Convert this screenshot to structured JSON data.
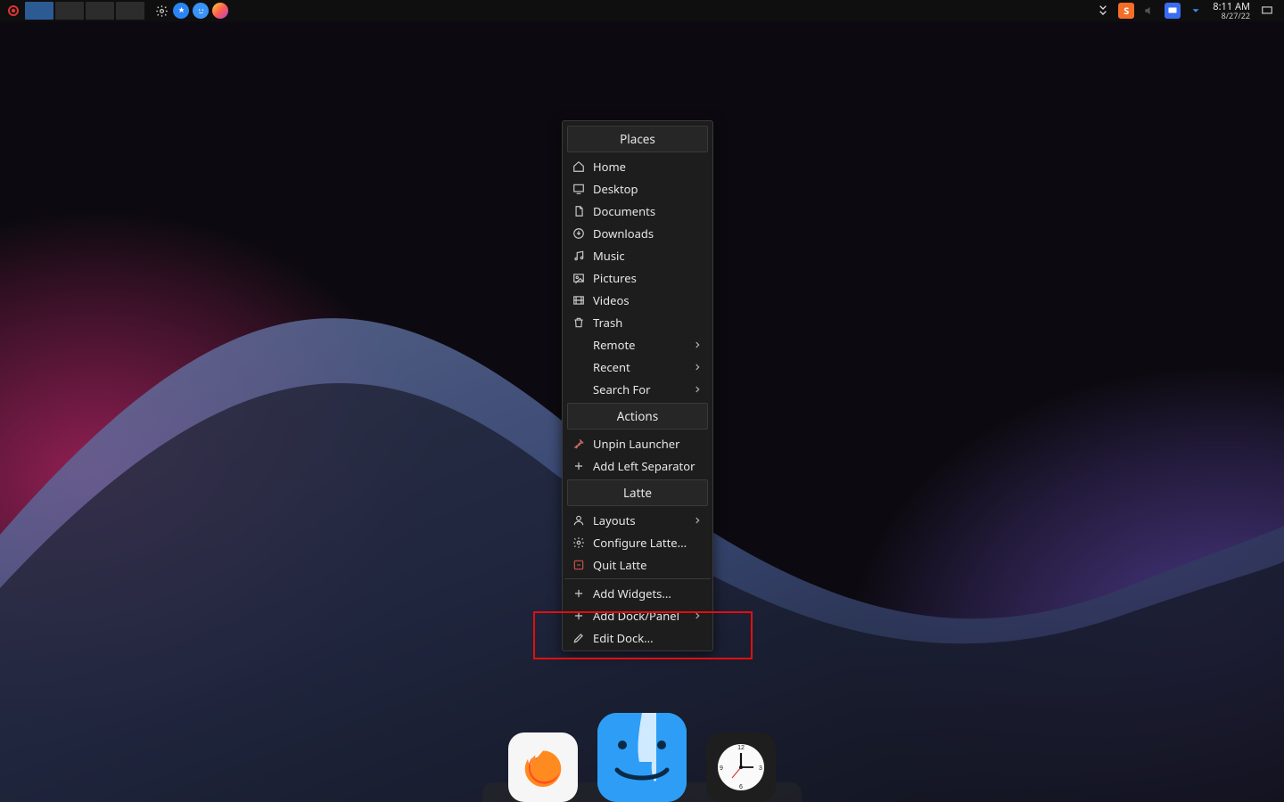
{
  "clock": {
    "time": "8:11 AM",
    "date": "8/27/22"
  },
  "menu": {
    "places_header": "Places",
    "places": [
      {
        "icon": "home-icon",
        "label": "Home"
      },
      {
        "icon": "desktop-icon",
        "label": "Desktop"
      },
      {
        "icon": "documents-icon",
        "label": "Documents"
      },
      {
        "icon": "downloads-icon",
        "label": "Downloads"
      },
      {
        "icon": "music-icon",
        "label": "Music"
      },
      {
        "icon": "pictures-icon",
        "label": "Pictures"
      },
      {
        "icon": "videos-icon",
        "label": "Videos"
      },
      {
        "icon": "trash-icon",
        "label": "Trash"
      }
    ],
    "places_sub": [
      {
        "label": "Remote"
      },
      {
        "label": "Recent"
      },
      {
        "label": "Search For"
      }
    ],
    "actions_header": "Actions",
    "actions": [
      {
        "icon": "unpin-icon",
        "label": "Unpin Launcher"
      },
      {
        "icon": "plus-icon",
        "label": "Add Left Separator"
      }
    ],
    "latte_header": "Latte",
    "latte": [
      {
        "icon": "user-icon",
        "label": "Layouts",
        "submenu": true
      },
      {
        "icon": "gear-icon",
        "label": "Configure Latte..."
      },
      {
        "icon": "quit-icon",
        "label": "Quit Latte"
      }
    ],
    "extra": [
      {
        "icon": "plus-icon",
        "label": "Add Widgets..."
      },
      {
        "icon": "plus-icon",
        "label": "Add Dock/Panel",
        "submenu": true
      },
      {
        "icon": "pencil-icon",
        "label": "Edit Dock..."
      }
    ]
  },
  "top_panel": {
    "tray_orange_label": "S"
  }
}
